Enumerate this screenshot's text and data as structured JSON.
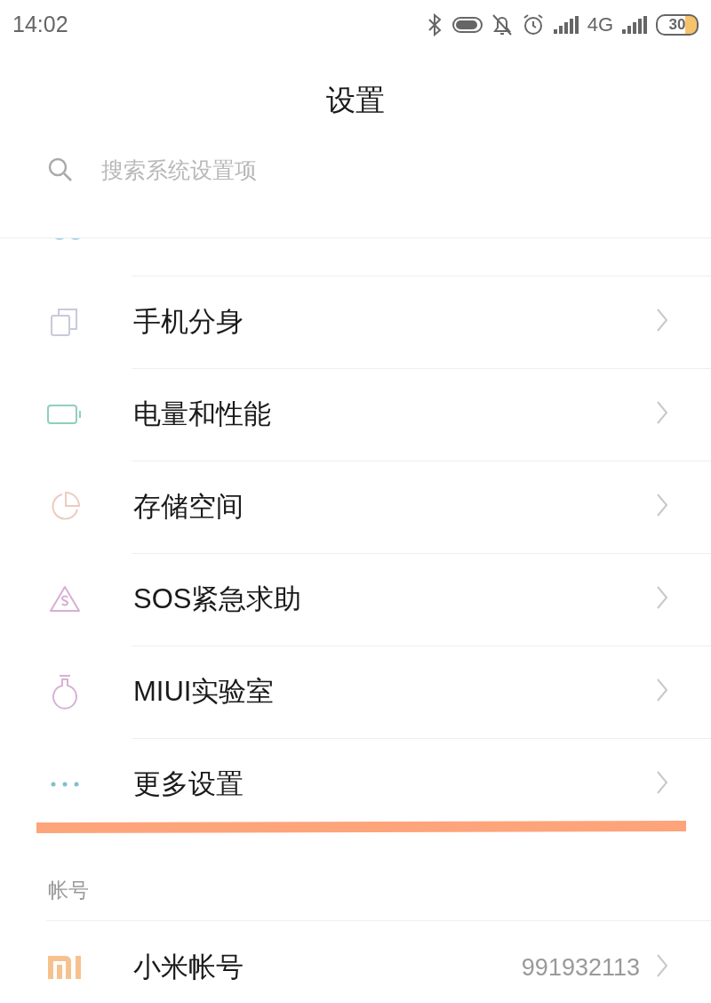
{
  "status_bar": {
    "time": "14:02",
    "network": "4G",
    "battery": "30"
  },
  "title": "设置",
  "search": {
    "placeholder": "搜索系统设置项"
  },
  "items": [
    {
      "kind": "clone",
      "label": "手机分身"
    },
    {
      "kind": "battery",
      "label": "电量和性能"
    },
    {
      "kind": "storage",
      "label": "存储空间"
    },
    {
      "kind": "sos",
      "label": "SOS紧急求助"
    },
    {
      "kind": "lab",
      "label": "MIUI实验室"
    },
    {
      "kind": "more",
      "label": "更多设置"
    }
  ],
  "account_section": {
    "label": "帐号",
    "items": [
      {
        "kind": "mi",
        "label": "小米帐号",
        "value": "991932113"
      }
    ]
  }
}
